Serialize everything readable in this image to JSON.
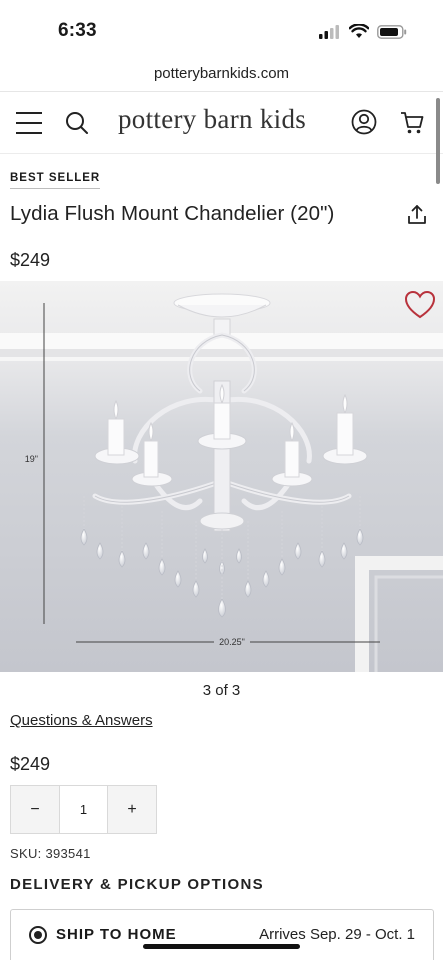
{
  "status_bar": {
    "time": "6:33",
    "icons": [
      "signal-icon",
      "wifi-icon",
      "battery-icon"
    ]
  },
  "browser": {
    "url": "potterybarnkids.com"
  },
  "header": {
    "brand": "pottery barn kids",
    "icons": [
      "menu-icon",
      "search-icon",
      "account-icon",
      "cart-icon"
    ]
  },
  "product": {
    "badge": "BEST SELLER",
    "title": "Lydia Flush Mount Chandelier (20\")",
    "price": "$249",
    "image": {
      "height_label": "19\"",
      "width_label": "20.25\""
    },
    "pager": "3 of 3",
    "qa_link": "Questions & Answers",
    "price_repeat": "$249",
    "quantity": {
      "decrement": "−",
      "value": "1",
      "increment": "+"
    },
    "sku": "SKU: 393541"
  },
  "delivery": {
    "section_title": "DELIVERY & PICKUP OPTIONS",
    "option_label": "SHIP TO HOME",
    "arrival": "Arrives Sep. 29 - Oct. 1"
  },
  "colors": {
    "heart": "#b8323c",
    "text": "#1a1a1a",
    "wall_top": "#eeeeee",
    "wall_bottom": "#c9cbd2"
  }
}
